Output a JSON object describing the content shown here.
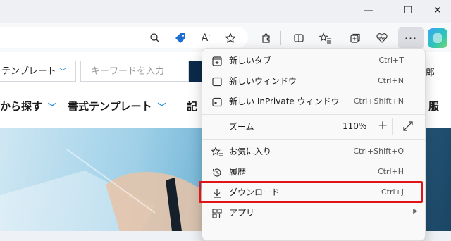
{
  "window": {
    "minimize_glyph": "—",
    "maximize_glyph": "☐",
    "close_glyph": "✕"
  },
  "toolbar": {
    "more_glyph": "···",
    "icons": [
      "zoom-icon",
      "tag-icon",
      "read-aloud-icon",
      "favorite-star-icon",
      "extensions-icon",
      "split-screen-icon",
      "favorites-icon",
      "collections-icon",
      "browser-essentials-icon",
      "more-icon",
      "copilot-icon"
    ]
  },
  "site": {
    "template_select": "テンプレート",
    "keyword_placeholder": "キーワードを入力",
    "nav": [
      "から探す",
      "書式テンプレート",
      "記"
    ],
    "side_text_top": "郎",
    "side_text_nav": "服"
  },
  "menu": {
    "items": [
      {
        "label": "新しいタブ",
        "shortcut": "Ctrl+T",
        "icon": "new-tab-icon"
      },
      {
        "label": "新しいウィンドウ",
        "shortcut": "Ctrl+N",
        "icon": "new-window-icon"
      },
      {
        "label": "新しい InPrivate ウィンドウ",
        "shortcut": "Ctrl+Shift+N",
        "icon": "inprivate-icon"
      },
      {
        "label": "お気に入り",
        "shortcut": "Ctrl+Shift+O",
        "icon": "favorites-icon"
      },
      {
        "label": "履歴",
        "shortcut": "Ctrl+H",
        "icon": "history-icon"
      },
      {
        "label": "ダウンロード",
        "shortcut": "Ctrl+J",
        "icon": "download-icon"
      },
      {
        "label": "アプリ",
        "shortcut": "",
        "icon": "apps-icon"
      }
    ],
    "zoom": {
      "label": "ズーム",
      "minus": "—",
      "value": "110%",
      "plus": "+"
    },
    "highlighted_item": "ダウンロード"
  },
  "colors": {
    "highlight": "#e1141b",
    "accent": "#2a92d6"
  }
}
